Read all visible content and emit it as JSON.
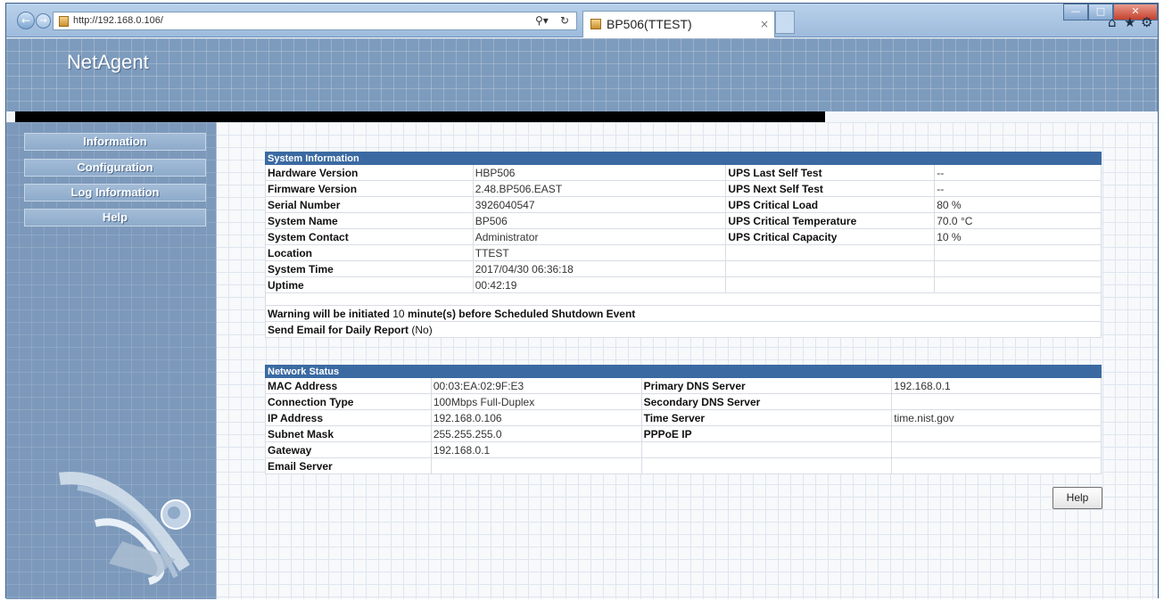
{
  "browser": {
    "url": "http://192.168.0.106/",
    "tab_title": "BP506(TTEST)",
    "tab_close": "×",
    "icons": [
      "back-arrow-icon",
      "forward-arrow-icon",
      "search-icon",
      "refresh-icon",
      "home-icon",
      "star-icon",
      "gear-icon"
    ]
  },
  "header": {
    "logo": "NetAgent"
  },
  "sidebar": {
    "items": [
      {
        "label": "Information"
      },
      {
        "label": "Configuration"
      },
      {
        "label": "Log Information"
      },
      {
        "label": "Help"
      }
    ]
  },
  "system_information": {
    "title": "System Information",
    "rows": [
      {
        "l1": "Hardware Version",
        "v1": "HBP506",
        "l2": "UPS Last Self Test",
        "v2": "--"
      },
      {
        "l1": "Firmware Version",
        "v1": "2.48.BP506.EAST",
        "l2": "UPS Next Self Test",
        "v2": "--"
      },
      {
        "l1": "Serial Number",
        "v1": "3926040547",
        "l2": "UPS Critical Load",
        "v2": "80 %"
      },
      {
        "l1": "System Name",
        "v1": "BP506",
        "l2": "UPS Critical Temperature",
        "v2": "70.0 °C"
      },
      {
        "l1": "System Contact",
        "v1": "Administrator",
        "l2": "UPS Critical Capacity",
        "v2": "10 %"
      },
      {
        "l1": "Location",
        "v1": "TTEST",
        "l2": "",
        "v2": ""
      },
      {
        "l1": "System Time",
        "v1": "2017/04/30 06:36:18",
        "l2": "",
        "v2": ""
      },
      {
        "l1": "Uptime",
        "v1": "00:42:19",
        "l2": "",
        "v2": ""
      }
    ],
    "warning_prefix": "Warning will be initiated",
    "warning_minutes": "10",
    "warning_suffix": "minute(s) before Scheduled Shutdown Event",
    "daily_report_label": "Send Email for Daily Report",
    "daily_report_value": "(No)"
  },
  "network_status": {
    "title": "Network Status",
    "rows": [
      {
        "l1": "MAC Address",
        "v1": "00:03:EA:02:9F:E3",
        "l2": "Primary DNS Server",
        "v2": "192.168.0.1"
      },
      {
        "l1": "Connection Type",
        "v1": "100Mbps Full-Duplex",
        "l2": "Secondary DNS Server",
        "v2": ""
      },
      {
        "l1": "IP Address",
        "v1": "192.168.0.106",
        "l2": "Time Server",
        "v2": "time.nist.gov"
      },
      {
        "l1": "Subnet Mask",
        "v1": "255.255.255.0",
        "l2": "PPPoE IP",
        "v2": ""
      },
      {
        "l1": "Gateway",
        "v1": "192.168.0.1",
        "l2": "",
        "v2": ""
      },
      {
        "l1": "Email Server",
        "v1": "",
        "l2": "",
        "v2": ""
      }
    ]
  },
  "help_button": "Help"
}
